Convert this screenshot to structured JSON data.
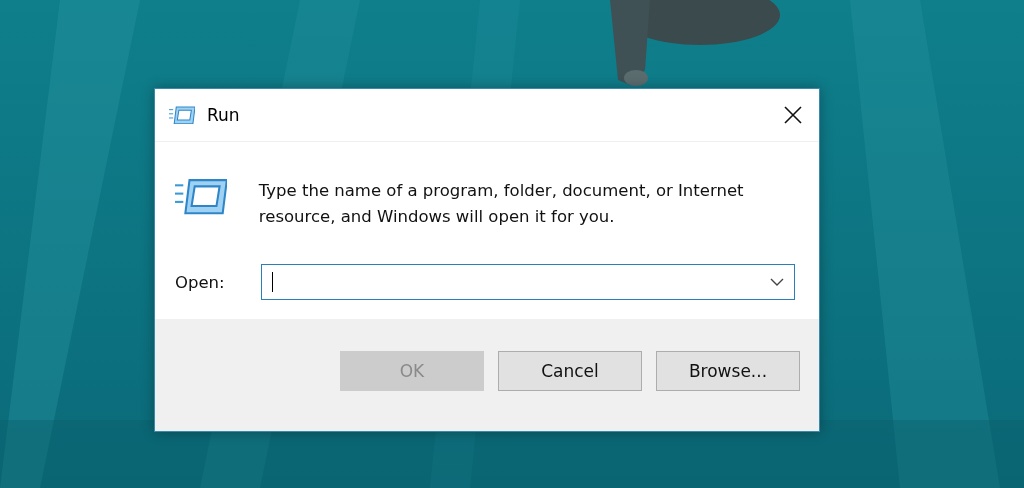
{
  "window": {
    "title": "Run"
  },
  "message": "Type the name of a program, folder, document, or Internet resource, and Windows will open it for you.",
  "open_field": {
    "label": "Open:"
  },
  "buttons": [
    {
      "label": "OK",
      "disabled": true
    },
    {
      "label": "Cancel",
      "disabled": false
    },
    {
      "label": "Browse...",
      "disabled": false
    }
  ]
}
